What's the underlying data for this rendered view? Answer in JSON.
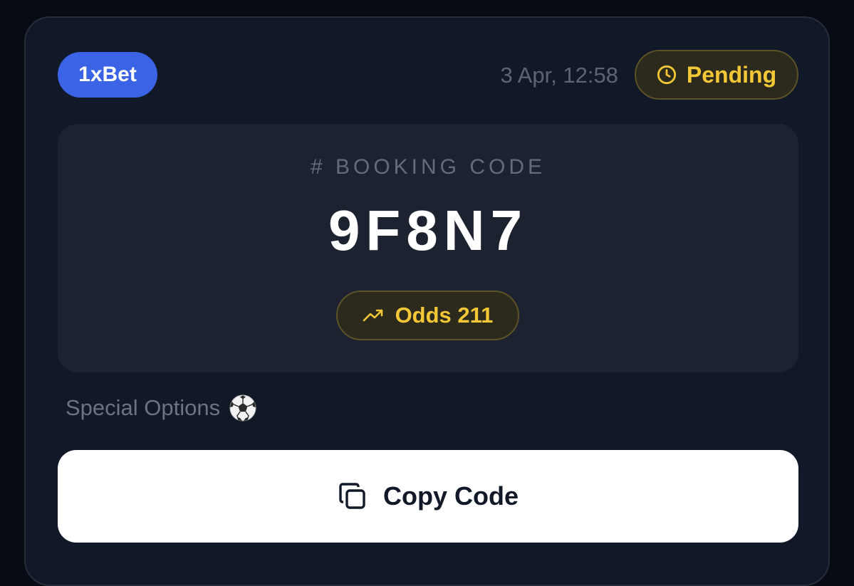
{
  "header": {
    "bookmaker": "1xBet",
    "timestamp": "3 Apr, 12:58",
    "status": "Pending"
  },
  "booking": {
    "label": "# BOOKING CODE",
    "code": "9F8N7",
    "odds_label": "Odds 211"
  },
  "special_options": {
    "label": "Special Options"
  },
  "actions": {
    "copy_label": "Copy Code"
  },
  "colors": {
    "background": "#080b14",
    "card": "#111827",
    "panel": "#1c2230",
    "brand": "#3a63e6",
    "accent": "#f3c736",
    "muted": "#646c7c",
    "button": "#ffffff"
  },
  "icons": {
    "status": "clock-icon",
    "odds": "trending-up-icon",
    "special": "soccer-ball-icon",
    "copy": "copy-icon"
  }
}
